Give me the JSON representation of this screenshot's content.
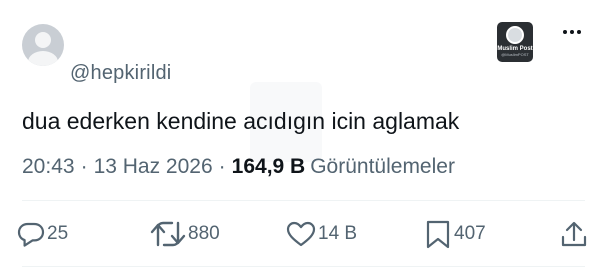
{
  "post": {
    "handle": "@hepkirildi",
    "text": "dua ederken kendine acıdıgın icin aglamak",
    "time": "20:43",
    "date": "13 Haz 2026",
    "separator": "·",
    "views_count": "164,9 B",
    "views_label": "Görüntülemeler"
  },
  "logo": {
    "brand": "Muslim Post",
    "tag": "@MuslimPOST"
  },
  "actions": {
    "replies": "25",
    "reposts": "880",
    "likes": "14 B",
    "bookmarks": "407"
  },
  "icons": {
    "reply": "speech-bubble",
    "repost": "repeat-arrows",
    "like": "heart",
    "bookmark": "bookmark",
    "share": "upload-arrow",
    "more": "three-dots"
  },
  "colors": {
    "text": "#0f1419",
    "muted": "#536471",
    "divider": "#eff3f4"
  }
}
